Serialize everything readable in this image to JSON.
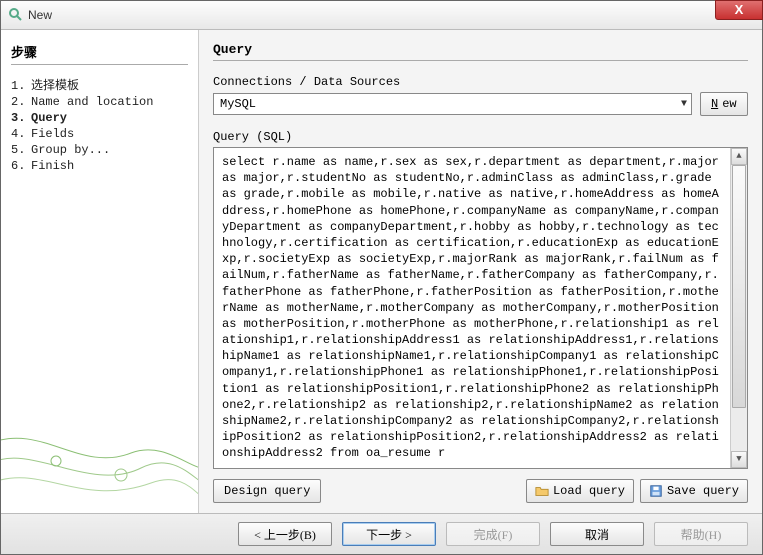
{
  "window": {
    "title": "New"
  },
  "sidebar": {
    "heading": "步骤",
    "steps": [
      {
        "num": "1.",
        "label": "选择模板"
      },
      {
        "num": "2.",
        "label": "Name and location"
      },
      {
        "num": "3.",
        "label": "Query",
        "current": true
      },
      {
        "num": "4.",
        "label": "Fields"
      },
      {
        "num": "5.",
        "label": "Group by..."
      },
      {
        "num": "6.",
        "label": "Finish"
      }
    ]
  },
  "main": {
    "heading": "Query",
    "connections_label": "Connections / Data Sources",
    "connection_selected": "MySQL",
    "new_btn": "New",
    "query_label": "Query (SQL)",
    "query_text": "select r.name as name,r.sex as sex,r.department as department,r.major as major,r.studentNo as studentNo,r.adminClass as adminClass,r.grade as grade,r.mobile as mobile,r.native as native,r.homeAddress as homeAddress,r.homePhone as homePhone,r.companyName as companyName,r.companyDepartment as companyDepartment,r.hobby as hobby,r.technology as technology,r.certification as certification,r.educationExp as educationExp,r.societyExp as societyExp,r.majorRank as majorRank,r.failNum as failNum,r.fatherName as fatherName,r.fatherCompany as fatherCompany,r.fatherPhone as fatherPhone,r.fatherPosition as fatherPosition,r.motherName as motherName,r.motherCompany as motherCompany,r.motherPosition as motherPosition,r.motherPhone as motherPhone,r.relationship1 as relationship1,r.relationshipAddress1 as relationshipAddress1,r.relationshipName1 as relationshipName1,r.relationshipCompany1 as relationshipCompany1,r.relationshipPhone1 as relationshipPhone1,r.relationshipPosition1 as relationshipPosition1,r.relationshipPhone2 as relationshipPhone2,r.relationship2 as relationship2,r.relationshipName2 as relationshipName2,r.relationshipCompany2 as relationshipCompany2,r.relationshipPosition2 as relationshipPosition2,r.relationshipAddress2 as relationshipAddress2 from oa_resume r",
    "design_btn": "Design query",
    "load_btn": "Load query",
    "save_btn": "Save query"
  },
  "footer": {
    "back": "< 上一步(B)",
    "next": "下一步 >",
    "finish": "完成(F)",
    "cancel": "取消",
    "help": "帮助(H)"
  }
}
